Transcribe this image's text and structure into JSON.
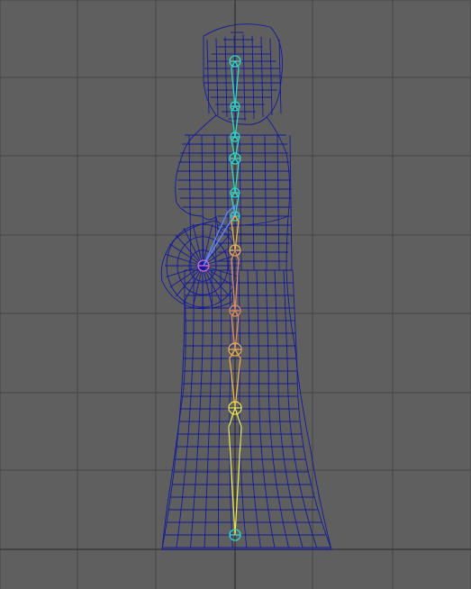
{
  "viewport": {
    "view": "side",
    "background_color": "#5f5f5f",
    "grid_color": "#454545",
    "grid_axis_color": "#3a3a3a"
  },
  "model": {
    "type": "wireframe-mesh",
    "wire_color": "#141a9a"
  },
  "skeleton": {
    "joint_colors": {
      "spine": "#2fd7c6",
      "neck_head": "#2fd7c6",
      "arm": "#5f89ff",
      "hand": "#d06ad6",
      "pelvis": "#d88a6a",
      "leg_upper": "#e7b04a",
      "leg_lower": "#e6e64a"
    }
  }
}
